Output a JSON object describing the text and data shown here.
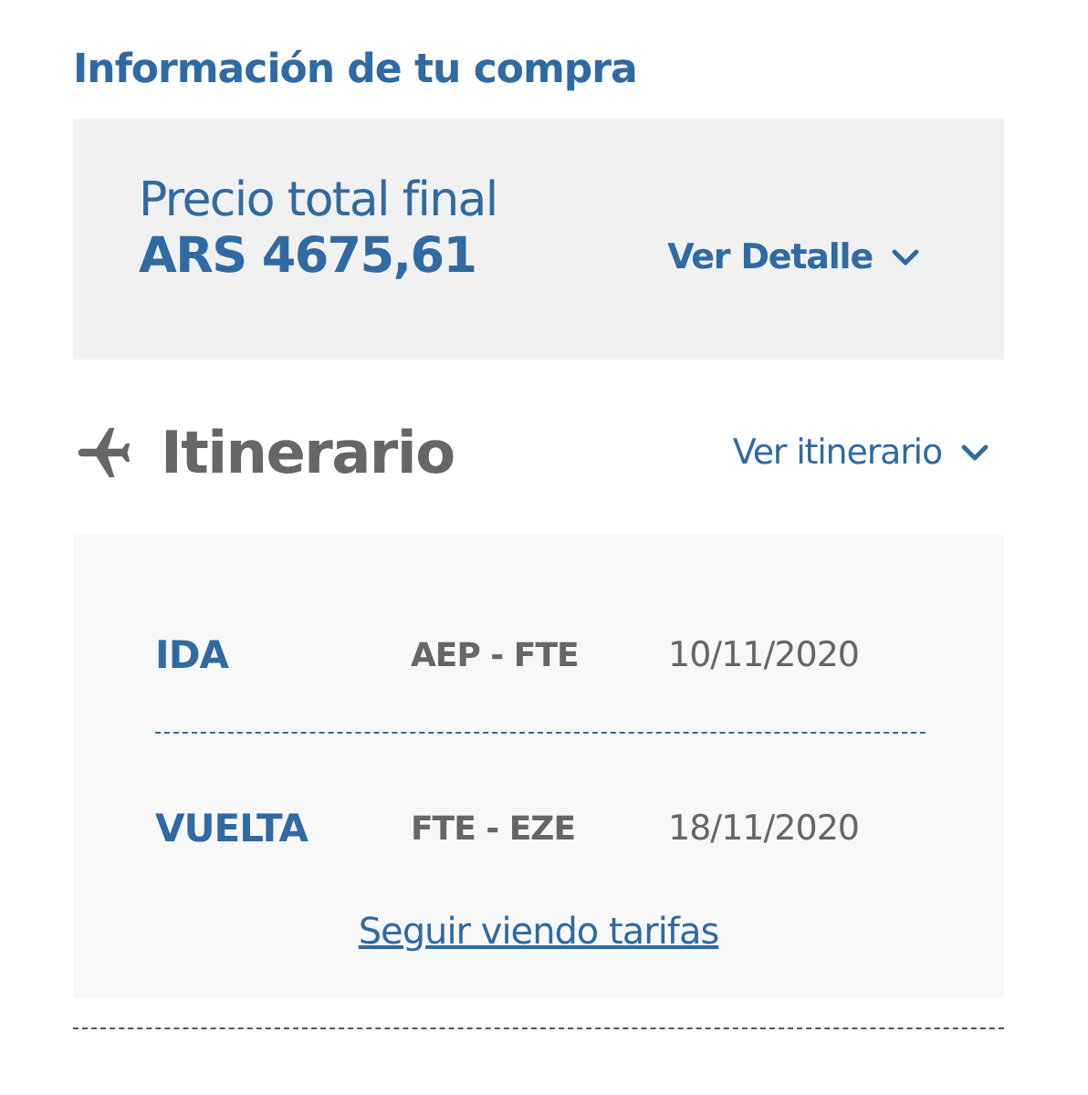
{
  "title": "Información de tu compra",
  "price": {
    "label": "Precio total final",
    "amount": "ARS 4675,61",
    "detail_link": "Ver Detalle"
  },
  "itinerary": {
    "heading": "Itinerario",
    "toggle": "Ver itinerario",
    "legs": [
      {
        "direction": "IDA",
        "route": "AEP - FTE",
        "date": "10/11/2020"
      },
      {
        "direction": "VUELTA",
        "route": "FTE - EZE",
        "date": "18/11/2020"
      }
    ],
    "link": "Seguir viendo tarifas"
  }
}
